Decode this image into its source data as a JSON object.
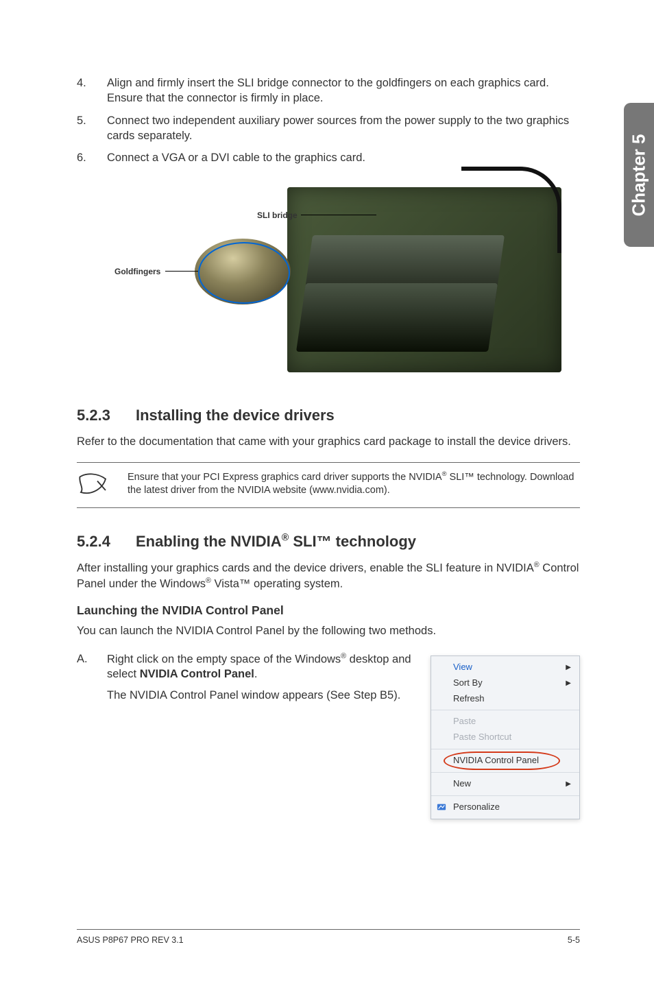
{
  "sideTab": "Chapter 5",
  "steps": [
    {
      "num": "4.",
      "text": "Align and firmly insert the SLI bridge connector to the goldfingers on each graphics card. Ensure that the connector is firmly in place."
    },
    {
      "num": "5.",
      "text": "Connect two independent auxiliary power sources from the power supply to the two graphics cards separately."
    },
    {
      "num": "6.",
      "text": "Connect a VGA or a DVI cable to the graphics card."
    }
  ],
  "figure": {
    "sliLabel": "SLI bridge",
    "goldLabel": "Goldfingers"
  },
  "sec523": {
    "num": "5.2.3",
    "title": "Installing the device drivers",
    "body": "Refer to the documentation that came with your graphics card package to install the device drivers.",
    "note_pre": "Ensure that your PCI Express graphics card driver supports the NVIDIA",
    "note_reg": "®",
    "note_post": " SLI™ technology. Download the latest driver from the NVIDIA website (www.nvidia.com)."
  },
  "sec524": {
    "num": "5.2.4",
    "title_pre": "Enabling the NVIDIA",
    "title_reg": "®",
    "title_post": " SLI™ technology",
    "body_pre": "After installing your graphics cards and the device drivers, enable the SLI feature in NVIDIA",
    "body_reg1": "®",
    "body_mid": " Control Panel under the Windows",
    "body_reg2": "®",
    "body_post": " Vista™ operating system.",
    "subhead": "Launching the NVIDIA Control Panel",
    "subbody": "You can launch the NVIDIA Control Panel by the following two methods.",
    "stepA": {
      "letter": "A.",
      "line1_pre": "Right click on the empty space of the Windows",
      "line1_reg": "®",
      "line1_post": " desktop and select ",
      "line1_bold": "NVIDIA Control Panel",
      "line1_end": ".",
      "line2": "The NVIDIA Control Panel window appears (See Step B5)."
    }
  },
  "menu": {
    "view": "View",
    "sortby": "Sort By",
    "refresh": "Refresh",
    "paste": "Paste",
    "pasteShortcut": "Paste Shortcut",
    "nvidia": "NVIDIA Control Panel",
    "new": "New",
    "personalize": "Personalize"
  },
  "footer": {
    "left": "ASUS P8P67 PRO REV 3.1",
    "right": "5-5"
  }
}
